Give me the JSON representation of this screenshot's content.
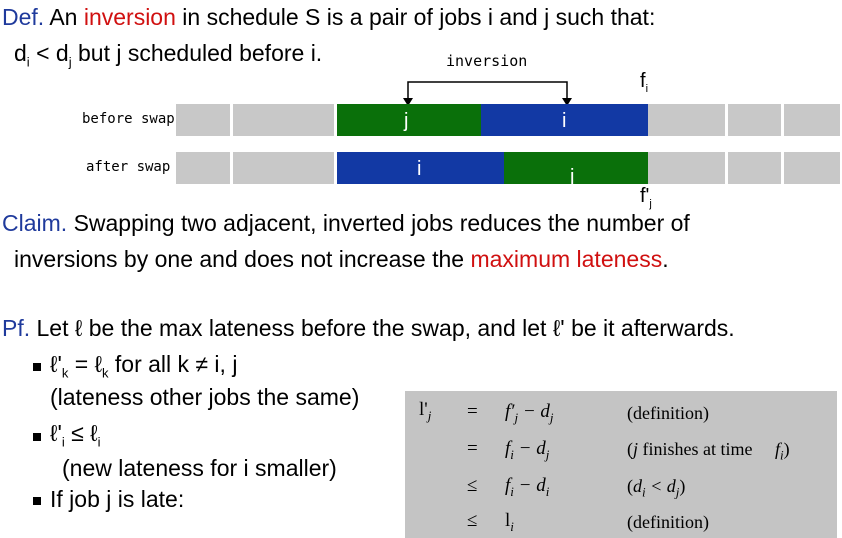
{
  "definition": {
    "label": "Def.",
    "text_pre": "An",
    "term": "inversion",
    "text_post": "in schedule S is a pair of jobs i and j such that:",
    "cond_d": "d",
    "cond_i": "i",
    "cond_lt": "< d",
    "cond_j": "j",
    "cond_rest": "but j scheduled before i."
  },
  "diagram": {
    "arrow_label": "inversion",
    "f_top": "f",
    "f_top_sub": "i",
    "f_bottom": "f'",
    "f_bottom_sub": "j",
    "rows": [
      {
        "label": "before swap",
        "cells": [
          {
            "text": "j",
            "color": "#0a700a"
          },
          {
            "text": "i",
            "color": "#1239a4"
          }
        ]
      },
      {
        "label": "after swap",
        "cells": [
          {
            "text": "i",
            "color": "#1239a4"
          },
          {
            "text": "j",
            "color": "#0a700a"
          }
        ]
      }
    ]
  },
  "claim": {
    "label": "Claim.",
    "line1": "Swapping two adjacent, inverted jobs reduces the number of",
    "line2_pre": "inversions by one and does not increase the",
    "line2_term": "maximum lateness",
    "line2_post": "."
  },
  "proof": {
    "label": "Pf.",
    "intro_a": "Let",
    "intro_b": "be the max lateness before the swap, and let",
    "intro_c": "' be it afterwards.",
    "ell": "ℓ",
    "bullets": [
      {
        "main_ell": "ℓ",
        "main_mid": "'",
        "sub_k": "k",
        "main_eq": "=",
        "ell2": "ℓ",
        "sub_k2": "k",
        "main_rest": "for all k ≠ i, j",
        "note": "(lateness other jobs the same)"
      },
      {
        "main_ell": "ℓ",
        "main_mid": "'",
        "sub_i": "i",
        "main_le": "≤",
        "ell2": "ℓ",
        "sub_i2": "i",
        "note": "(new lateness for i smaller)"
      },
      {
        "text": "If job j is late:"
      }
    ]
  },
  "math": {
    "rows": [
      {
        "lhs": "l'",
        "lhs_sub": "j",
        "rel": "=",
        "expr": "f′",
        "expr_sub": "j",
        "expr_rest": "− d",
        "expr_sub2": "j",
        "note": "(definition)"
      },
      {
        "lhs": "",
        "lhs_sub": "",
        "rel": "=",
        "expr": "f",
        "expr_sub": "i",
        "expr_rest": "− d",
        "expr_sub2": "j",
        "note_a": "(",
        "note_b": "j",
        "note_c": "finishes at time",
        "note_d": "f",
        "note_e": "i",
        "note_f": ")"
      },
      {
        "lhs": "",
        "lhs_sub": "",
        "rel": "≤",
        "expr": "f",
        "expr_sub": "i",
        "expr_rest": "− d",
        "expr_sub2": "i",
        "note_a": "(",
        "note_b": "d",
        "note_e": "i",
        "note_c": "< d",
        "note_d": "j",
        "note_f": ")"
      },
      {
        "lhs": "",
        "lhs_sub": "",
        "rel": "≤",
        "expr": "l",
        "expr_sub": "i",
        "note": "(definition)"
      }
    ]
  }
}
